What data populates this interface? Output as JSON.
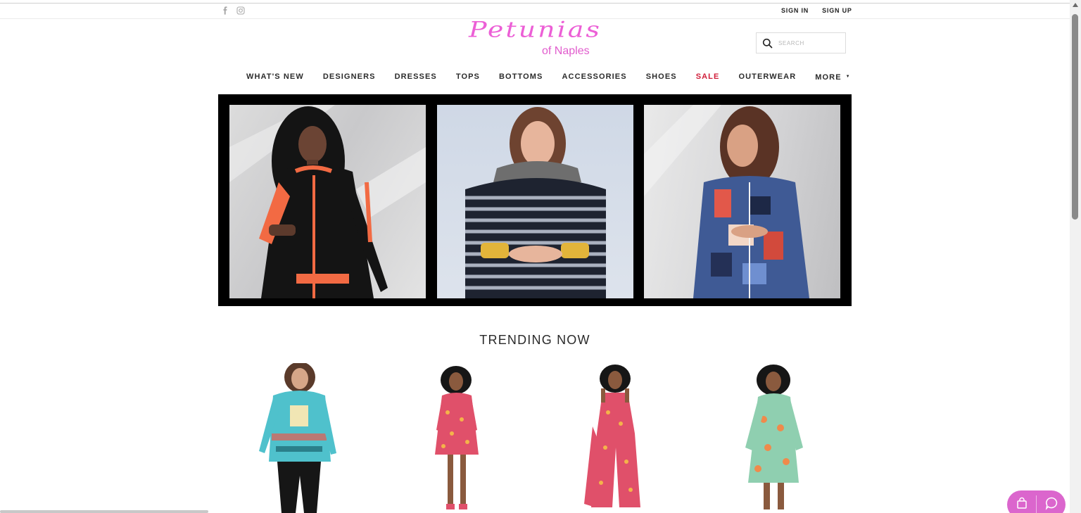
{
  "topbar": {
    "social": [
      {
        "icon": "facebook-icon"
      },
      {
        "icon": "instagram-icon"
      }
    ],
    "sign_in": "SIGN IN",
    "sign_up": "SIGN UP"
  },
  "logo": {
    "main": "Petunias",
    "sub": "of Naples",
    "color": "#ec5fd6"
  },
  "search": {
    "placeholder": "SEARCH"
  },
  "nav": {
    "items": [
      {
        "label": "WHAT'S NEW"
      },
      {
        "label": "DESIGNERS"
      },
      {
        "label": "DRESSES"
      },
      {
        "label": "TOPS"
      },
      {
        "label": "BOTTOMS"
      },
      {
        "label": "ACCESSORIES"
      },
      {
        "label": "SHOES"
      },
      {
        "label": "SALE",
        "color": "#d01e3a"
      },
      {
        "label": "OUTERWEAR"
      },
      {
        "label": "MORE"
      }
    ]
  },
  "hero": {
    "photos": [
      {
        "description_icon": "model-photo"
      },
      {
        "description_icon": "model-photo"
      },
      {
        "description_icon": "model-photo"
      }
    ]
  },
  "trending": {
    "title": "TRENDING NOW"
  },
  "widget": {
    "buttons": [
      {
        "icon": "shopping-bag-icon"
      },
      {
        "icon": "chat-bubble-icon"
      }
    ],
    "color": "#db66cd"
  }
}
